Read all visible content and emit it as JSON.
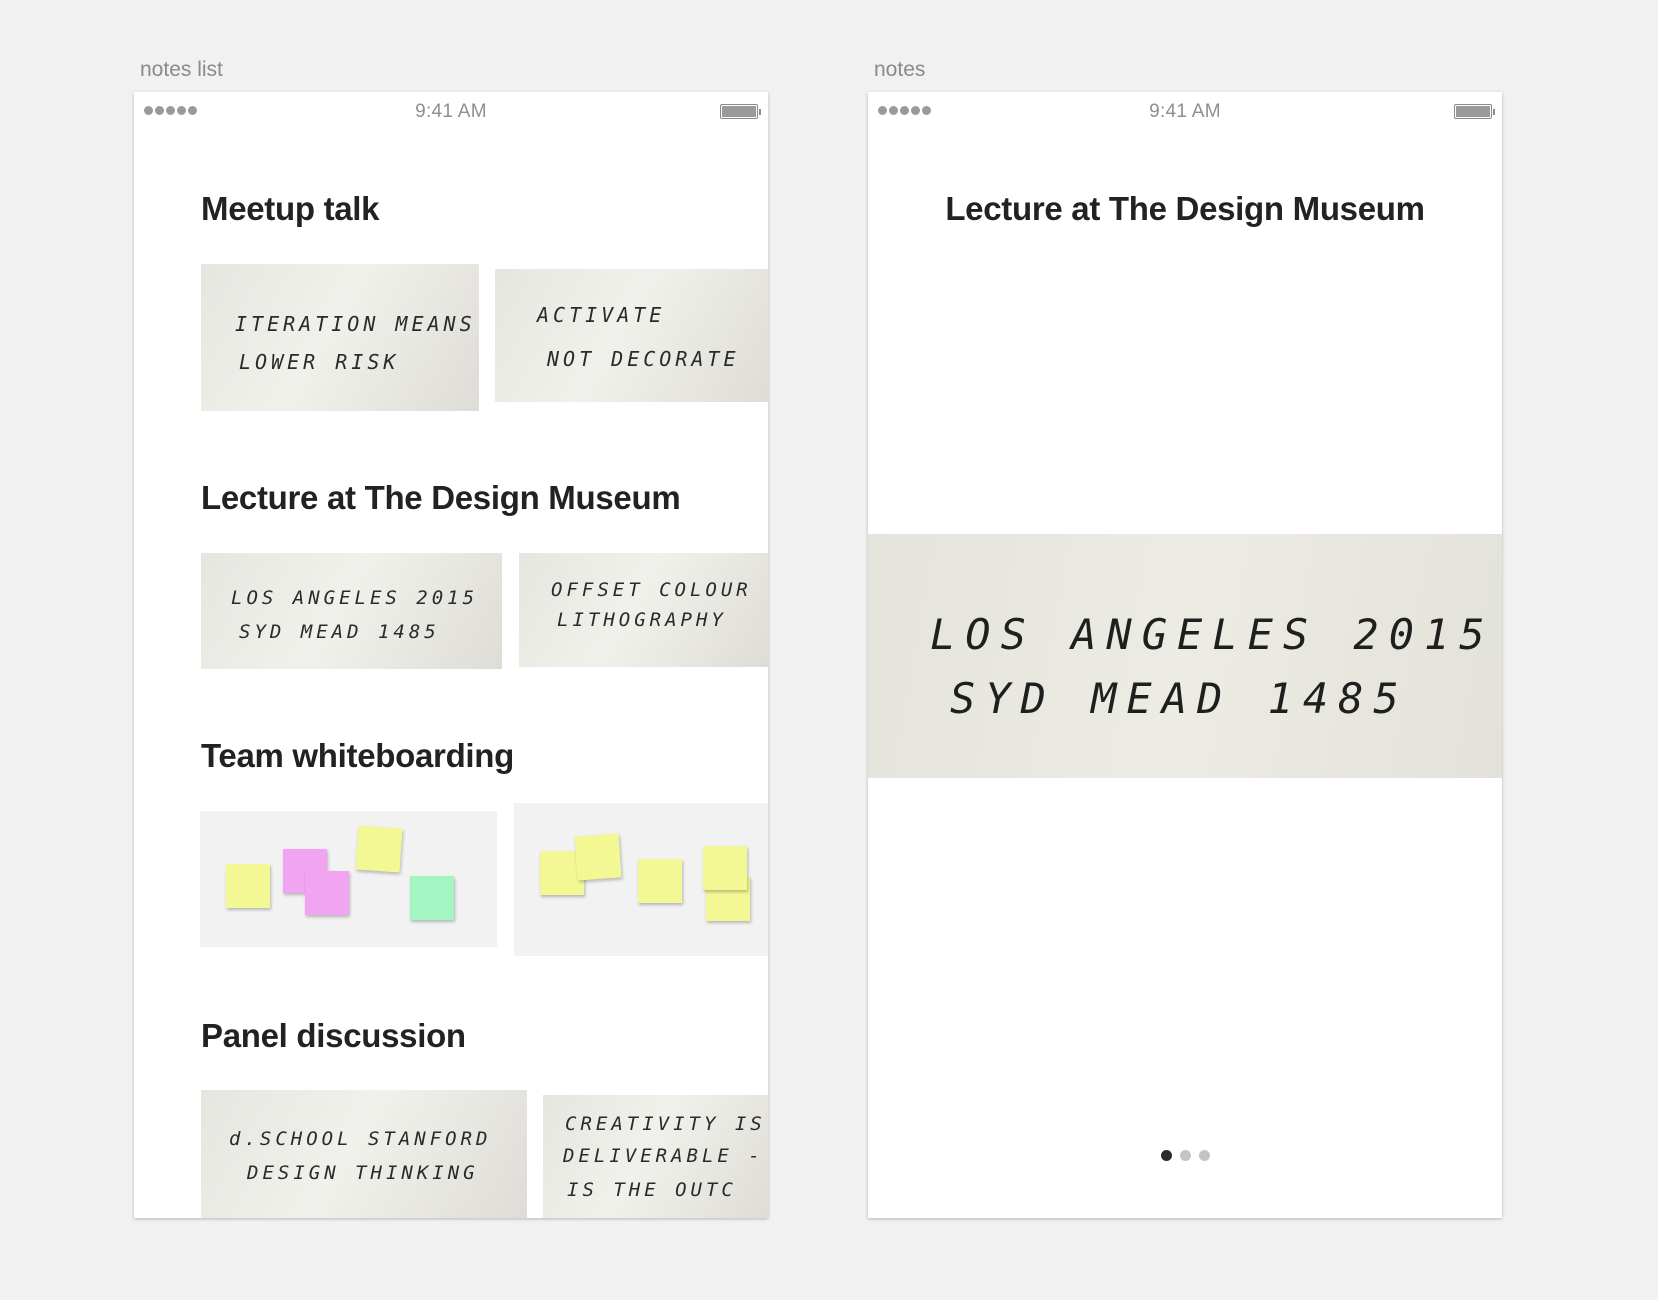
{
  "artboards": {
    "list_label": "notes list",
    "detail_label": "notes"
  },
  "status_bar": {
    "time": "9:41 AM"
  },
  "notes_list": {
    "sections": [
      {
        "title": "Meetup talk",
        "notes": [
          {
            "lines": [
              "ITERATION MEANS",
              "LOWER RISK"
            ]
          },
          {
            "lines": [
              "ACTIVATE",
              "NOT DECORATE"
            ]
          }
        ]
      },
      {
        "title": "Lecture at The Design Museum",
        "notes": [
          {
            "lines": [
              "LOS ANGELES 2015",
              "SYD MEAD 1485"
            ]
          },
          {
            "lines": [
              "OFFSET COLOUR",
              "LITHOGRAPHY"
            ]
          }
        ]
      },
      {
        "title": "Team whiteboarding",
        "notes": [
          {
            "type": "sticky-notes"
          },
          {
            "type": "sticky-notes"
          }
        ]
      },
      {
        "title": "Panel discussion",
        "notes": [
          {
            "lines": [
              "d.SCHOOL STANFORD",
              "DESIGN THINKING"
            ]
          },
          {
            "lines": [
              "CREATIVITY IS",
              "DELIVERABLE -",
              "IS THE OUTC"
            ]
          }
        ]
      }
    ]
  },
  "note_detail": {
    "title": "Lecture at The Design Museum",
    "note_lines": [
      "LOS ANGELES 2015",
      "SYD MEAD 1485"
    ],
    "page_count": 3,
    "current_page": 1
  },
  "colors": {
    "background": "#f1f1f1",
    "title_text": "#222222",
    "sticky_yellow": "#f3f894",
    "sticky_pink": "#f1a4f2",
    "sticky_green": "#a3f5c2",
    "page_dot_active": "#2b2b2b",
    "page_dot_inactive": "#c4c4c4"
  },
  "icons": [
    "signal-icon",
    "battery-icon"
  ]
}
